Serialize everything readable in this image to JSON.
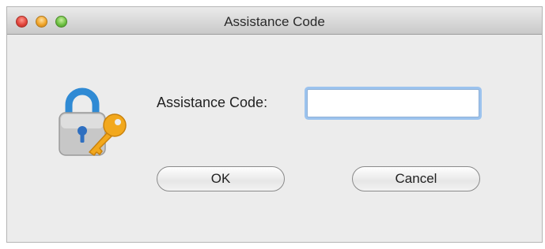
{
  "window": {
    "title": "Assistance Code"
  },
  "form": {
    "label": "Assistance Code:",
    "input_value": ""
  },
  "buttons": {
    "ok_label": "OK",
    "cancel_label": "Cancel"
  },
  "icons": {
    "lock": "lock-with-key-icon"
  },
  "colors": {
    "close": "#e2463d",
    "minimize": "#f0a52a",
    "zoom": "#6fc143",
    "lock_body": "#c4c4c4",
    "lock_shackle": "#2f8ad4",
    "key": "#f2a81d",
    "focus_ring": "#9cc3ee"
  }
}
